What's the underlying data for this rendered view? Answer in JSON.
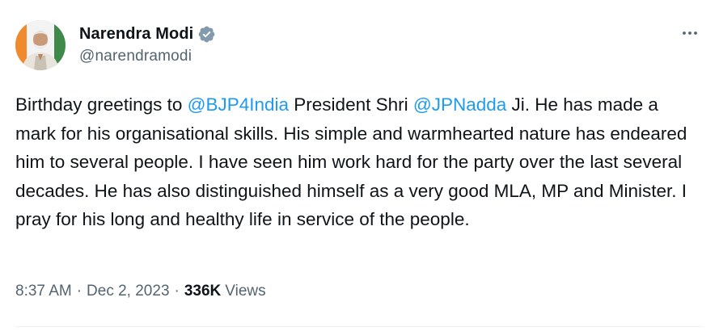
{
  "author": {
    "display_name": "Narendra Modi",
    "handle": "@narendramodi",
    "verified_icon": "verified-badge-icon",
    "avatar_icon": "avatar"
  },
  "menu": {
    "more_icon": "more-horizontal-icon"
  },
  "tweet": {
    "segments": [
      {
        "text": "Birthday greetings to ",
        "type": "text"
      },
      {
        "text": "@BJP4India",
        "type": "mention"
      },
      {
        "text": " President Shri ",
        "type": "text"
      },
      {
        "text": "@JPNadda",
        "type": "mention"
      },
      {
        "text": " Ji. He has made a mark for his organisational skills. His simple and warmhearted nature has endeared him to several people. I have seen him work hard for the party over the last several decades. He has also distinguished himself as a very good MLA, MP and Minister. I pray for his long and healthy life in service of the people.",
        "type": "text"
      }
    ]
  },
  "meta": {
    "time": "8:37 AM",
    "separator": "·",
    "date": "Dec 2, 2023",
    "views_count": "336K",
    "views_label": "Views"
  },
  "colors": {
    "text": "#0f1419",
    "secondary": "#536471",
    "link": "#1d9bf0",
    "verified": "#829aab"
  }
}
